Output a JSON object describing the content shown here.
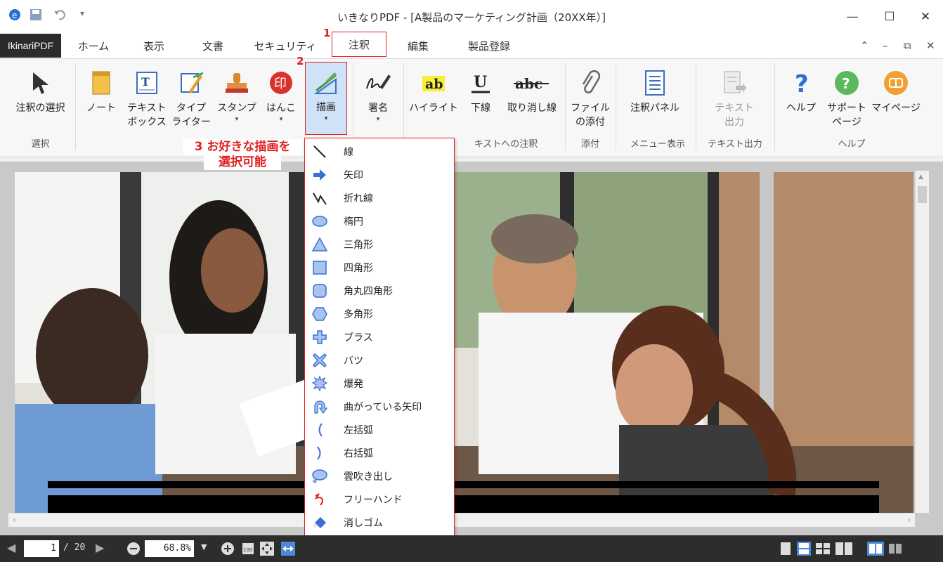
{
  "window": {
    "title": "いきなりPDF - [A製品のマーケティング計画（20XX年）]",
    "controls": [
      "minimize-icon",
      "maximize-icon",
      "close-icon"
    ]
  },
  "app_button": "IkinariPDF",
  "tabs": [
    "ホーム",
    "表示",
    "文書",
    "セキュリティ",
    "注釈",
    "編集",
    "製品登録"
  ],
  "active_tab": "注釈",
  "ribbon": {
    "select": {
      "label": "注釈の選択",
      "group": "選択"
    },
    "buttons": {
      "note": "ノート",
      "textbox": "テキスト\nボックス",
      "typewriter": "タイプ\nライター",
      "stamp": "スタンプ",
      "hanko": "はんこ",
      "drawing": "描画",
      "signature": "署名",
      "highlight": "ハイライト",
      "underline": "下線",
      "strikeout": "取り消し線",
      "attach": "ファイル\nの添付",
      "panel": "注釈パネル",
      "textout": "テキスト\n出力",
      "help": "ヘルプ",
      "support": "サポート\nページ",
      "mypage": "マイページ"
    },
    "groups": {
      "text_annot": "キストへの注釈",
      "attach": "添付",
      "menu": "メニュー表示",
      "textout": "テキスト出力",
      "help": "ヘルプ"
    },
    "icon_text": {
      "highlight": "ab",
      "underline": "U",
      "strike": "abc",
      "hanko": "印"
    }
  },
  "annotations": {
    "step1": "1",
    "step2": "2",
    "step3_line1": "3 お好きな描画を",
    "step3_line2": "選択可能"
  },
  "draw_menu": [
    {
      "label": "線",
      "icon": "line-icon"
    },
    {
      "label": "矢印",
      "icon": "arrow-icon"
    },
    {
      "label": "折れ線",
      "icon": "polyline-icon"
    },
    {
      "label": "楕円",
      "icon": "ellipse-icon"
    },
    {
      "label": "三角形",
      "icon": "triangle-icon"
    },
    {
      "label": "四角形",
      "icon": "rectangle-icon"
    },
    {
      "label": "角丸四角形",
      "icon": "rounded-rectangle-icon"
    },
    {
      "label": "多角形",
      "icon": "polygon-icon"
    },
    {
      "label": "プラス",
      "icon": "plus-icon"
    },
    {
      "label": "バツ",
      "icon": "cross-icon"
    },
    {
      "label": "爆発",
      "icon": "explosion-icon"
    },
    {
      "label": "曲がっている矢印",
      "icon": "curved-arrow-icon"
    },
    {
      "label": "左括弧",
      "icon": "left-bracket-icon"
    },
    {
      "label": "右括弧",
      "icon": "right-bracket-icon"
    },
    {
      "label": "雲吹き出し",
      "icon": "cloud-bubble-icon"
    },
    {
      "label": "フリーハンド",
      "icon": "freehand-icon"
    },
    {
      "label": "消しゴム",
      "icon": "eraser-icon"
    }
  ],
  "status": {
    "page": "1",
    "total": "/ 20",
    "zoom": "68.8%"
  },
  "colors": {
    "accent": "#e02020",
    "shape_blue": "#3b6fd6",
    "dark": "#2d2d2d"
  }
}
